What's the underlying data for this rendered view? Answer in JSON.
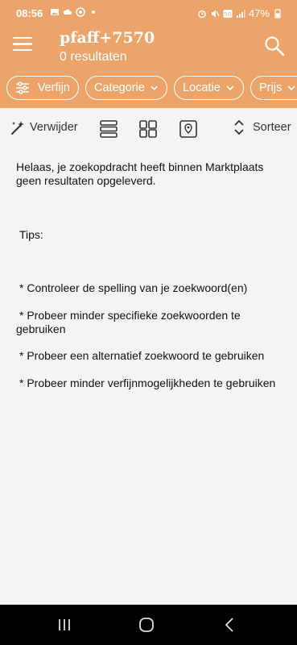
{
  "status": {
    "time": "08:56",
    "battery": "47%",
    "left_icons": [
      "image-icon",
      "cloud-icon",
      "whatsapp-icon",
      "dot-icon"
    ],
    "right_icons": [
      "alarm-icon",
      "mute-icon",
      "5g-icon",
      "signal-icon",
      "battery-icon"
    ]
  },
  "header": {
    "title": "pfaff+7570",
    "subtitle": "0 resultaten"
  },
  "filters": {
    "refine": "Verfijn",
    "category": "Categorie",
    "location": "Locatie",
    "price": "Prijs"
  },
  "toolbar": {
    "remove": "Verwijder",
    "sort": "Sorteer"
  },
  "message": {
    "no_results": "Helaas, je zoekopdracht heeft binnen Marktplaats geen resultaten opgeleverd.",
    "tips_label": "Tips:",
    "tips": [
      "* Controleer de spelling van je zoekwoord(en)",
      "* Probeer minder specifieke zoekwoorden te gebruiken",
      "* Probeer een alternatief zoekwoord te gebruiken",
      "* Probeer minder verfijnmogelijkheden te gebruiken"
    ]
  },
  "colors": {
    "brand": "#eda46a",
    "background": "#f4f4f2"
  }
}
